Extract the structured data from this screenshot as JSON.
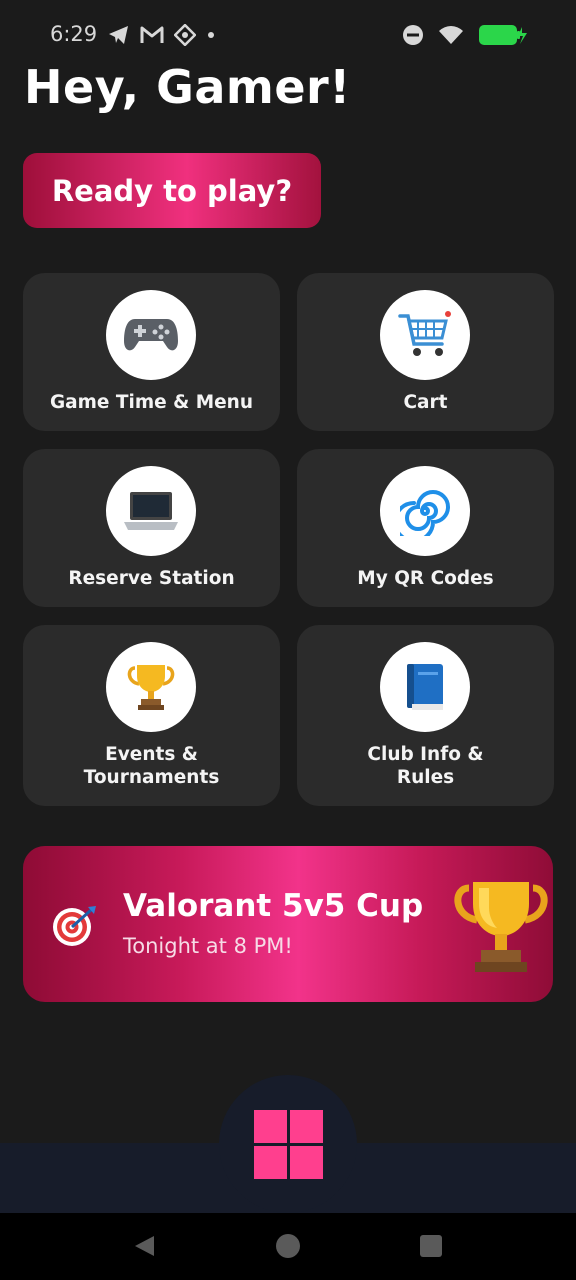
{
  "status_bar": {
    "time": "6:29",
    "left_icons": [
      "telegram-icon",
      "gmail-icon",
      "app-icon",
      "dot-icon"
    ],
    "right_icons": [
      "do-not-disturb-icon",
      "wifi-icon",
      "battery-charging-icon"
    ],
    "battery_color": "#2bd64a"
  },
  "greeting": "Hey, Gamer!",
  "cta_label": "Ready to play?",
  "tiles": [
    {
      "label": "Game Time & Menu",
      "icon": "gamepad-icon"
    },
    {
      "label": "Cart",
      "icon": "shopping-cart-icon"
    },
    {
      "label": "Reserve Station",
      "icon": "laptop-icon"
    },
    {
      "label": "My QR Codes",
      "icon": "swirl-icon"
    },
    {
      "label_line1": "Events &",
      "label_line2": "Tournaments",
      "icon": "trophy-icon"
    },
    {
      "label_line1": "Club Info &",
      "label_line2": "Rules",
      "icon": "book-icon"
    }
  ],
  "banner": {
    "title": "Valorant 5v5 Cup",
    "subtitle": "Tonight at 8 PM!",
    "left_icon": "target-icon",
    "right_icon": "trophy-icon"
  },
  "colors": {
    "accent": "#ff3f8e",
    "tile_bg": "#2b2b2b",
    "nav_bg": "#171c2a",
    "page_bg": "#1b1b1b"
  }
}
